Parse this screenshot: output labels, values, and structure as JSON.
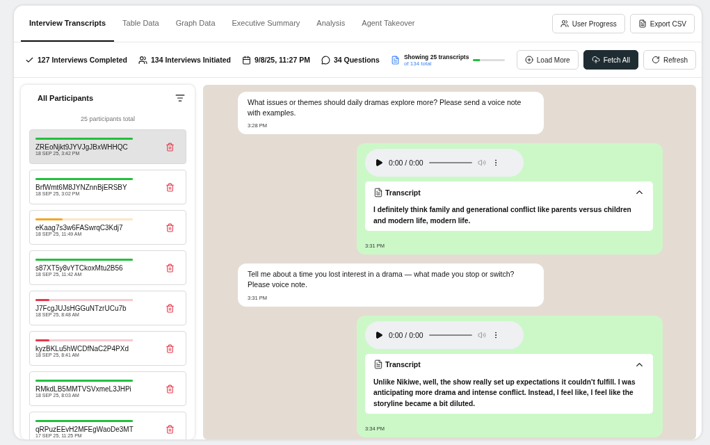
{
  "tabs": [
    {
      "label": "Interview Transcripts",
      "selected": true
    },
    {
      "label": "Table Data",
      "selected": false
    },
    {
      "label": "Graph Data",
      "selected": false
    },
    {
      "label": "Executive Summary",
      "selected": false
    },
    {
      "label": "Analysis",
      "selected": false
    },
    {
      "label": "Agent Takeover",
      "selected": false
    }
  ],
  "header_buttons": [
    {
      "label": "User Progress"
    },
    {
      "label": "Export CSV"
    }
  ],
  "stats": [
    {
      "label": "127 Interviews Completed"
    },
    {
      "label": "134 Interviews Initiated"
    },
    {
      "label": "9/8/25, 11:27 PM"
    },
    {
      "label": "34 Questions"
    }
  ],
  "showing": {
    "label": "Showing 25 transcripts",
    "sublabel": "of 134 total",
    "level": 0.2
  },
  "actions": [
    {
      "label": "Load More",
      "primary": false
    },
    {
      "label": "Fetch All",
      "primary": true
    },
    {
      "label": "Refresh",
      "primary": false
    }
  ],
  "participants_panel": {
    "title": "All Participants",
    "count": "25 participants total",
    "participants": [
      {
        "id": "ZREoNjkt9JYVJgJBxWHHQC",
        "date": "18 SEP 25, 3:42 PM",
        "level": 1,
        "color": "#22c03c",
        "selected": true
      },
      {
        "id": "BrfWmt6M8JYNZnnBjERSBY",
        "date": "18 SEP 25, 3:02 PM",
        "level": 1,
        "color": "#22c03c",
        "selected": false
      },
      {
        "id": "eKaag7s3w6FASwrqC3Kdj7",
        "date": "18 SEP 25, 11:49 AM",
        "level": 0.28,
        "color": "#f5a623",
        "selected": false
      },
      {
        "id": "s87XT5y8vYTCkoxMtu2B56",
        "date": "18 SEP 25, 11:42 AM",
        "level": 1,
        "color": "#22c03c",
        "selected": false
      },
      {
        "id": "J7FcgJUJsHGGuNTzrUCu7b",
        "date": "18 SEP 25, 8:48 AM",
        "level": 0.14,
        "color": "#e5384a",
        "selected": false
      },
      {
        "id": "kyzBKLu5hWCDfNaC2P4PXd",
        "date": "18 SEP 25, 8:41 AM",
        "level": 0.14,
        "color": "#e5384a",
        "selected": false
      },
      {
        "id": "RMkdLB5MMTVSVxmeL3JHPi",
        "date": "18 SEP 25, 8:03 AM",
        "level": 1,
        "color": "#22c03c",
        "selected": false
      },
      {
        "id": "qRPuzEEvH2MFEgWaoDe3MT",
        "date": "17 SEP 25, 11:25 PM",
        "level": 1,
        "color": "#22c03c",
        "selected": false
      }
    ]
  },
  "messages": [
    {
      "kind": "question",
      "text": "What issues or themes should daily dramas explore more? Please send a voice note with examples.",
      "time": "3:28 PM"
    },
    {
      "kind": "voice",
      "player_time": "0:00 / 0:00",
      "transcript_label": "Transcript",
      "expanded": true,
      "transcript": "I definitely think family and generational conflict like parents versus children and modern life, modern life.",
      "time": "3:31 PM"
    },
    {
      "kind": "question",
      "text": "Tell me about a time you lost interest in a drama — what made you stop or switch? Please voice note.",
      "time": "3:31 PM"
    },
    {
      "kind": "voice",
      "player_time": "0:00 / 0:00",
      "transcript_label": "Transcript",
      "expanded": true,
      "transcript": "Unlike Nikiwe, well, the show really set up expectations it couldn't fulfill. I was anticipating more drama and intense conflict. Instead, I feel like, I feel like the storyline became a bit diluted.",
      "time": "3:34 PM"
    }
  ]
}
